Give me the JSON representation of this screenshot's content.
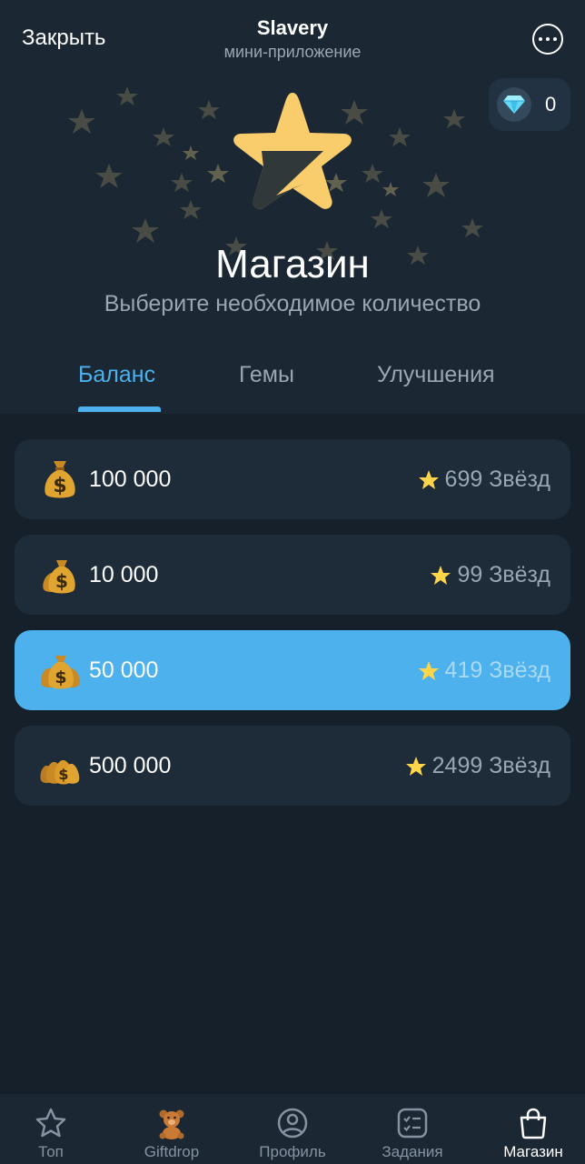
{
  "header": {
    "close_label": "Закрыть",
    "app_title": "Slavery",
    "app_subtitle": "мини-приложение",
    "more_icon": "more-icon"
  },
  "gems": {
    "count": "0",
    "icon": "diamond-icon"
  },
  "hero": {
    "title": "Магазин",
    "subtitle": "Выберите необходимое количество"
  },
  "tabs": [
    {
      "label": "Баланс",
      "active": true
    },
    {
      "label": "Гемы",
      "active": false
    },
    {
      "label": "Улучшения",
      "active": false
    }
  ],
  "products": [
    {
      "amount": "100 000",
      "price": "699 Звёзд",
      "icon": "money-bag-icon",
      "selected": false
    },
    {
      "amount": "10 000",
      "price": "99 Звёзд",
      "icon": "money-bags-icon",
      "selected": false
    },
    {
      "amount": "50 000",
      "price": "419 Звёзд",
      "icon": "money-bags-icon",
      "selected": true
    },
    {
      "amount": "500 000",
      "price": "2499 Звёзд",
      "icon": "money-bags-icon",
      "selected": false
    }
  ],
  "nav": [
    {
      "label": "Топ",
      "icon": "star-outline-icon",
      "active": false
    },
    {
      "label": "Giftdrop",
      "icon": "teddy-bear-icon",
      "active": false
    },
    {
      "label": "Профиль",
      "icon": "profile-icon",
      "active": false
    },
    {
      "label": "Задания",
      "icon": "tasks-icon",
      "active": false
    },
    {
      "label": "Магазин",
      "icon": "shopping-bag-icon",
      "active": true
    }
  ],
  "colors": {
    "accent": "#4cb1ec",
    "background": "#16202b",
    "card": "#1e2b38",
    "star": "#ffd54a"
  }
}
